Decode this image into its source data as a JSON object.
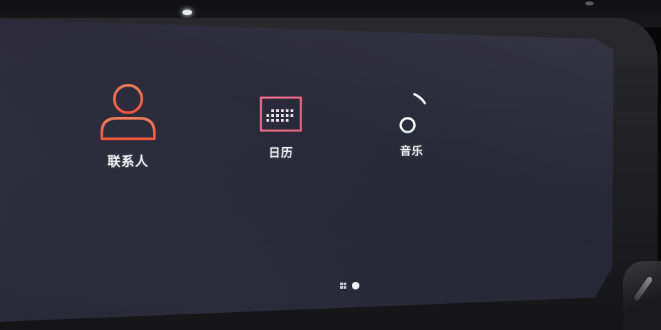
{
  "launcher": {
    "apps": [
      {
        "label": "联系人",
        "icon": "person-icon",
        "color": "#f2694d"
      },
      {
        "label": "日历",
        "icon": "calendar-icon",
        "color": "#f06a8a"
      },
      {
        "label": "音乐",
        "icon": "music-note-icon",
        "color": "#e9f2ee"
      }
    ]
  },
  "pager": {
    "pages": 2,
    "current_page": 2
  },
  "colors": {
    "screen_background": "#2a2a3a",
    "label_text": "#f2f2f4",
    "contacts_accent": "#f2694d",
    "calendar_accent": "#f06a8a"
  }
}
